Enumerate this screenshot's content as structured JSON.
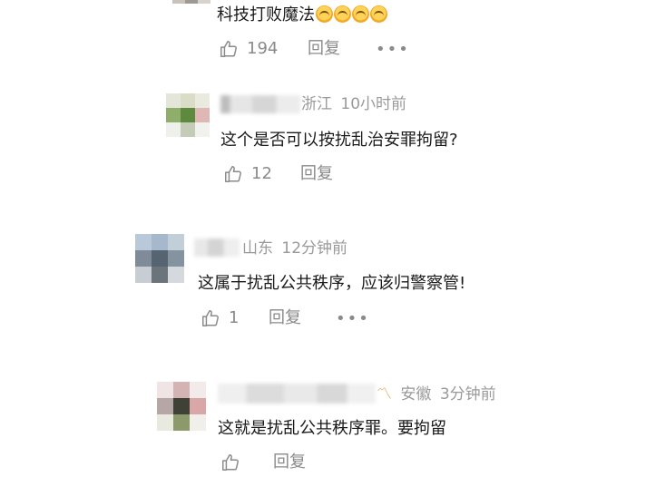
{
  "comments": [
    {
      "text": "科技打败魔法",
      "emoji_count": 4,
      "likes": "194",
      "reply_label": "回复",
      "more_label": "•••"
    },
    {
      "location": "浙江",
      "time": "10小时前",
      "text": "这个是否可以按扰乱治安罪拘留?",
      "likes": "12",
      "reply_label": "回复"
    },
    {
      "location": "山东",
      "time": "12分钟前",
      "text": "这属于扰乱公共秩序，应该归警察管!",
      "likes": "1",
      "reply_label": "回复",
      "more_label": "•••"
    },
    {
      "location": "安徽",
      "time": "3分钟前",
      "text": "这就是扰乱公共秩序罪。要拘留",
      "likes": "",
      "reply_label": "回复"
    }
  ],
  "icons": {
    "like": "thumbs-up-icon",
    "more": "more-dots-icon",
    "emoji": "laughing-emoji-icon"
  },
  "colors": {
    "text": "#1a1a1a",
    "meta": "#9a9a9a",
    "action": "#8a8a8a"
  }
}
